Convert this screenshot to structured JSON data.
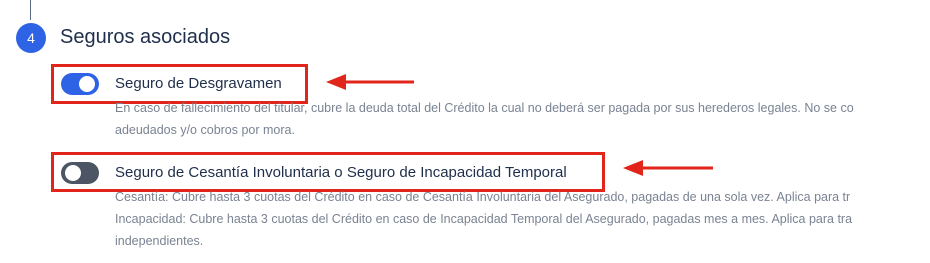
{
  "step": {
    "number": "4",
    "title": "Seguros asociados"
  },
  "insurances": [
    {
      "label": "Seguro de Desgravamen",
      "enabled": true,
      "description": [
        "En caso de fallecimiento del titular, cubre la deuda total del Crédito la cual no deberá ser pagada por sus herederos legales. No se co",
        "adeudados y/o cobros por mora."
      ]
    },
    {
      "label": "Seguro de Cesantía Involuntaria o Seguro de Incapacidad Temporal",
      "enabled": false,
      "description": [
        "Cesantía: Cubre hasta 3 cuotas del Crédito en caso de Cesantía Involuntaria del Asegurado, pagadas de una sola vez. Aplica para tr",
        "Incapacidad: Cubre hasta 3 cuotas del Crédito en caso de Incapacidad Temporal del Asegurado, pagadas mes a mes. Aplica para tra",
        "independientes."
      ]
    }
  ],
  "colors": {
    "accent": "#2f63e6",
    "toggle_off": "#4b5563",
    "annotation": "#e1251b"
  }
}
